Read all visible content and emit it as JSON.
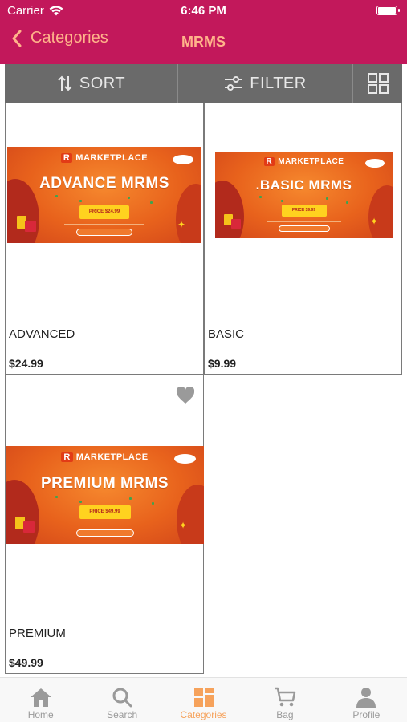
{
  "status_bar": {
    "carrier": "Carrier",
    "time": "6:46 PM"
  },
  "nav": {
    "back_label": "Categories",
    "title": "MRMS",
    "accent": "#c2185b",
    "text_color": "#ffb38a"
  },
  "toolbar": {
    "sort_label": "SORT",
    "filter_label": "FILTER"
  },
  "products": [
    {
      "name": "ADVANCED",
      "price": "$24.99",
      "banner_brand": "MARKETPLACE",
      "banner_title": "ADVANCE MRMS",
      "banner_price": "PRICE $24.99"
    },
    {
      "name": "BASIC",
      "price": "$9.99",
      "banner_brand": "MARKETPLACE",
      "banner_title": ".BASIC MRMS",
      "banner_price": "PRICE $9.99"
    },
    {
      "name": "PREMIUM",
      "price": "$49.99",
      "banner_brand": "MARKETPLACE",
      "banner_title": "PREMIUM MRMS",
      "banner_price": "PRICE $49.99",
      "favorite_icon": "heart-icon"
    }
  ],
  "tabbar": {
    "items": [
      {
        "label": "Home",
        "icon": "home-icon"
      },
      {
        "label": "Search",
        "icon": "search-icon"
      },
      {
        "label": "Categories",
        "icon": "categories-icon",
        "active": true
      },
      {
        "label": "Bag",
        "icon": "cart-icon"
      },
      {
        "label": "Profile",
        "icon": "profile-icon"
      }
    ]
  }
}
